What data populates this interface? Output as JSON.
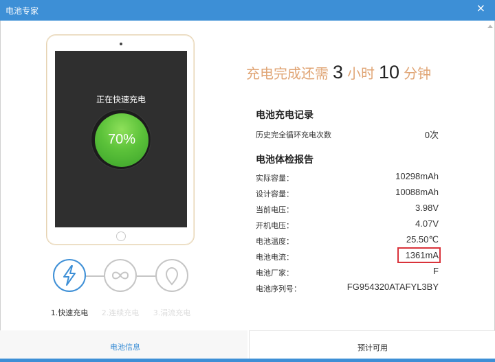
{
  "window": {
    "title": "电池专家",
    "close_glyph": "×"
  },
  "device": {
    "status_text": "正在快速充电",
    "battery_percent_label": "70%",
    "battery_percent": 70
  },
  "modes": [
    {
      "label": "1.快速充电",
      "icon": "lightning-icon",
      "active": true
    },
    {
      "label": "2.连续充电",
      "icon": "infinity-icon",
      "active": false
    },
    {
      "label": "3.涓流充电",
      "icon": "drop-icon",
      "active": false
    }
  ],
  "remaining": {
    "prefix": "充电完成还需",
    "hours": "3",
    "hours_unit": "小时",
    "minutes": "10",
    "minutes_unit": "分钟"
  },
  "charge_record": {
    "heading": "电池充电记录",
    "rows": [
      {
        "key": "历史完全循环充电次数",
        "value": "0次"
      }
    ]
  },
  "health_report": {
    "heading": "电池体检报告",
    "rows": [
      {
        "key": "实际容量：",
        "value": "10298mAh"
      },
      {
        "key": "设计容量：",
        "value": "10088mAh"
      },
      {
        "key": "当前电压：",
        "value": "3.98V"
      },
      {
        "key": "开机电压：",
        "value": "4.07V"
      },
      {
        "key": "电池温度：",
        "value": "25.50℃"
      },
      {
        "key": "电池电流：",
        "value": "1361mA"
      },
      {
        "key": "电池厂家：",
        "value": "F"
      },
      {
        "key": "电池序列号：",
        "value": "FG954320ATAFYL3BY"
      }
    ]
  },
  "bottom": {
    "left_link": "电池信息",
    "right_label": "预计可用"
  },
  "colors": {
    "accent": "#3d8fd6",
    "remaining_text": "#e0a575",
    "battery_green": "#5cc23a",
    "highlight_box": "#d9323a"
  }
}
